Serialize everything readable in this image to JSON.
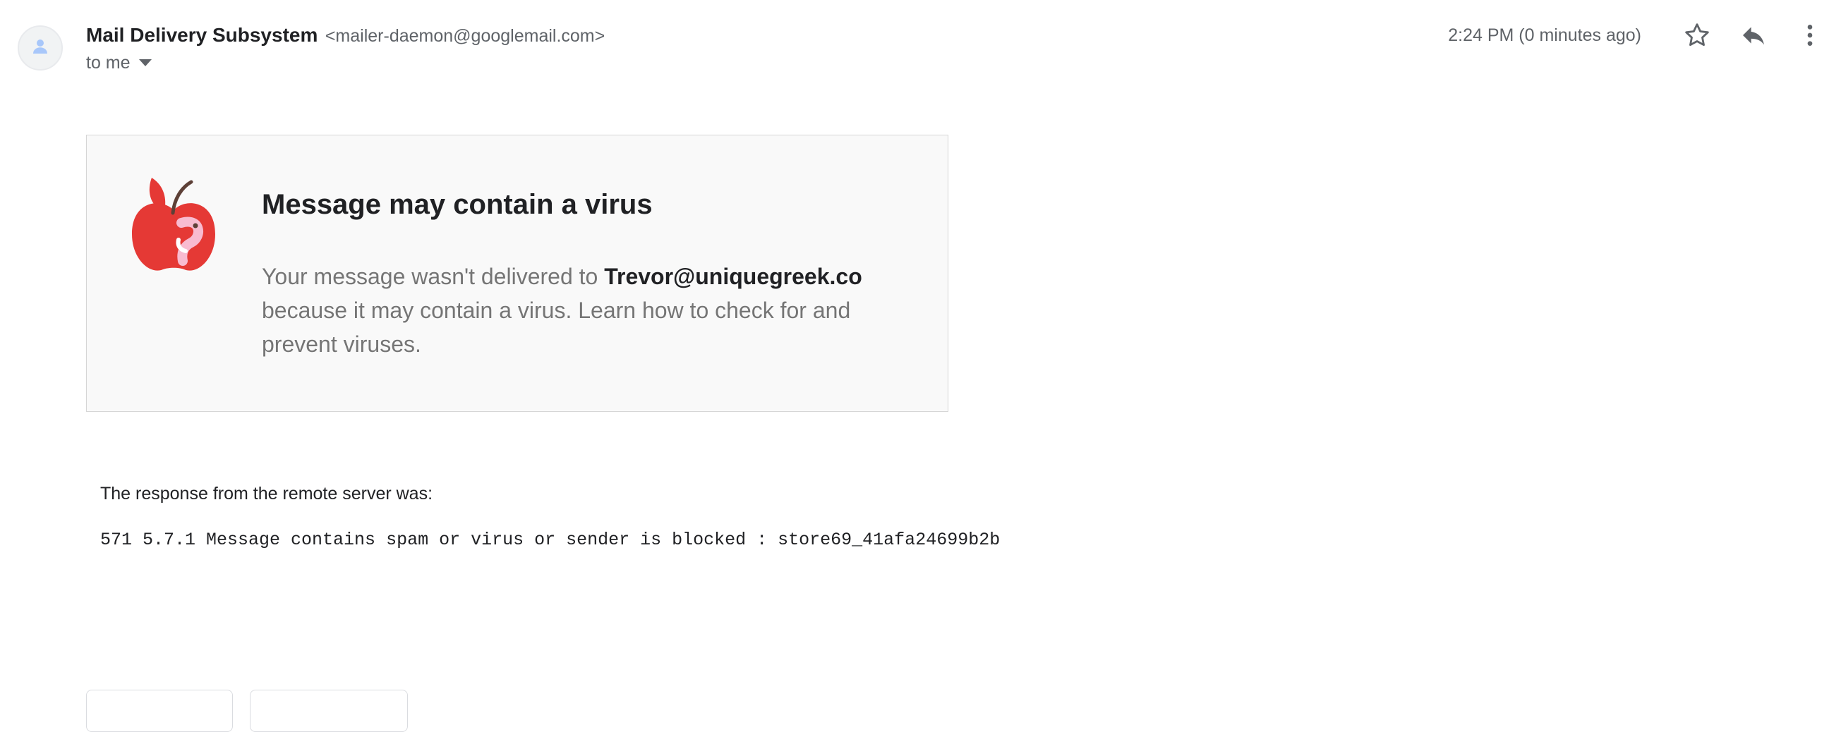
{
  "header": {
    "sender_name": "Mail Delivery Subsystem",
    "sender_email": "<mailer-daemon@googlemail.com>",
    "recipient_label": "to me",
    "timestamp": "2:24 PM (0 minutes ago)",
    "icons": {
      "avatar": "person-icon",
      "details": "chevron-down-icon",
      "star": "star-icon",
      "reply": "reply-icon",
      "more": "more-vert-icon"
    }
  },
  "warning": {
    "title": "Message may contain a virus",
    "body_prefix": "Your message wasn't delivered to ",
    "recipient": "Trevor@uniquegreek.co",
    "body_suffix": " because it may contain a virus. Learn how to check for and prevent viruses.",
    "illustration": "apple-worm-icon"
  },
  "response": {
    "label": "The response from the remote server was:",
    "code": "571 5.7.1 Message contains spam or virus or sender is blocked : store69_41afa24699b2b"
  },
  "colors": {
    "card_background": "#f9f9f9",
    "card_border": "#d6d6d6",
    "apple_red": "#e53935",
    "muted_text": "#757575",
    "avatar_icon": "#a8c7fa"
  }
}
